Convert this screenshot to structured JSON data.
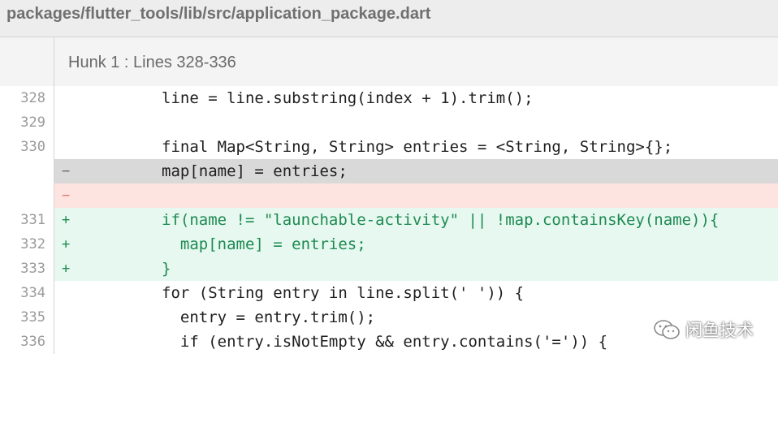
{
  "file": {
    "path": "packages/flutter_tools/lib/src/application_package.dart"
  },
  "hunk": {
    "title": "Hunk 1 : Lines 328-336"
  },
  "lines": [
    {
      "num": "328",
      "sign": "",
      "type": "ctx",
      "code": "line = line.substring(index + 1).trim();"
    },
    {
      "num": "329",
      "sign": "",
      "type": "ctx",
      "code": ""
    },
    {
      "num": "330",
      "sign": "",
      "type": "ctx",
      "code": "final Map<String, String> entries = <String, String>{};"
    },
    {
      "num": "",
      "sign": "−",
      "type": "del",
      "code": "map[name] = entries;"
    },
    {
      "num": "",
      "sign": "−",
      "type": "delempty",
      "code": ""
    },
    {
      "num": "331",
      "sign": "+",
      "type": "add",
      "code": "if(name != \"launchable-activity\" || !map.containsKey(name)){"
    },
    {
      "num": "332",
      "sign": "+",
      "type": "add",
      "code": "  map[name] = entries;"
    },
    {
      "num": "333",
      "sign": "+",
      "type": "add",
      "code": "}"
    },
    {
      "num": "334",
      "sign": "",
      "type": "ctx",
      "code": "for (String entry in line.split(' ')) {"
    },
    {
      "num": "335",
      "sign": "",
      "type": "ctx",
      "code": "  entry = entry.trim();"
    },
    {
      "num": "336",
      "sign": "",
      "type": "ctx",
      "code": "  if (entry.isNotEmpty && entry.contains('=')) {"
    }
  ],
  "watermark": {
    "icon": "wechat-icon",
    "text": "闲鱼技术"
  },
  "colors": {
    "added_bg": "#e6f8ef",
    "added_text": "#1e8a52",
    "removed_bg": "#d9d9d9",
    "removed_empty_bg": "#fde4e1",
    "header_bg": "#ededed"
  }
}
